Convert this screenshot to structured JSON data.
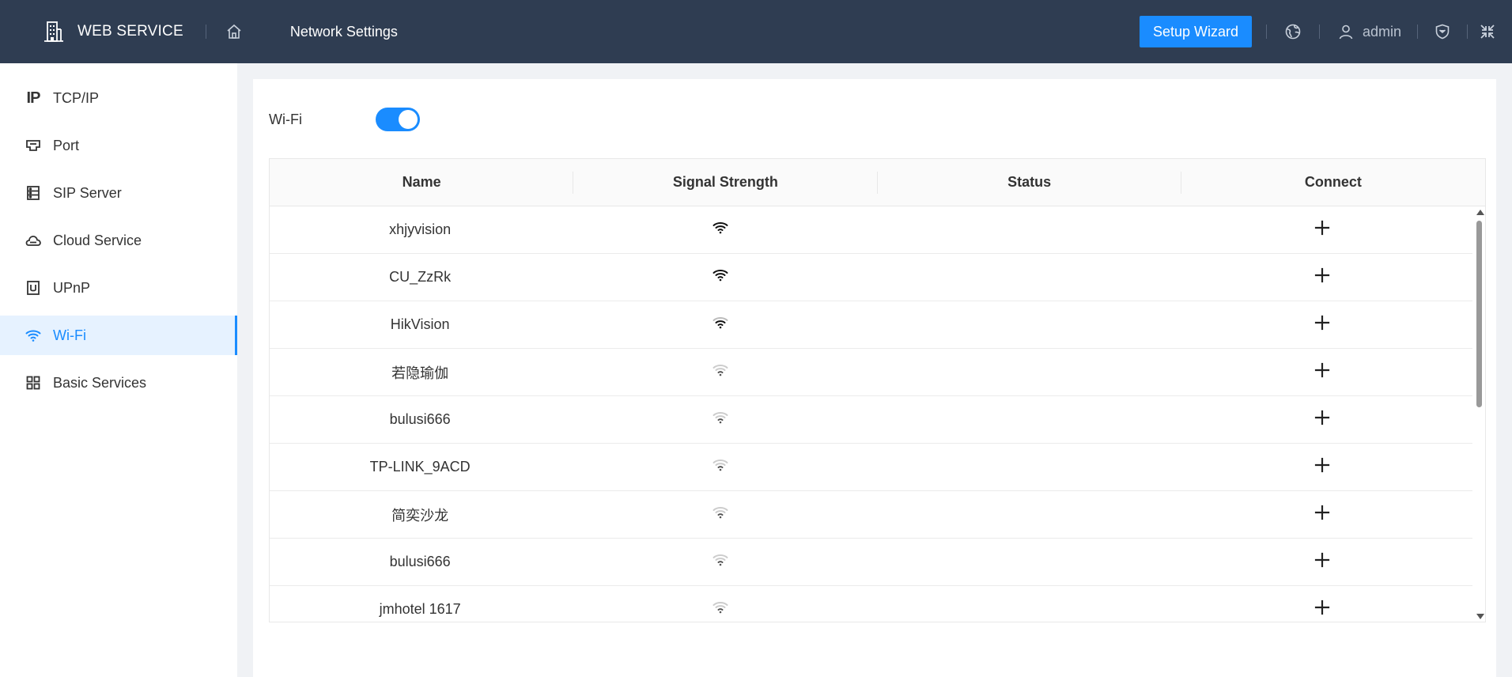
{
  "header": {
    "brand": "WEB SERVICE",
    "page_title": "Network Settings",
    "setup_wizard": "Setup Wizard",
    "user": "admin",
    "colors": {
      "bg": "#2f3d52",
      "accent": "#1a8cff"
    }
  },
  "sidebar": {
    "items": [
      {
        "label": "TCP/IP",
        "icon": "ip-icon"
      },
      {
        "label": "Port",
        "icon": "port-icon"
      },
      {
        "label": "SIP Server",
        "icon": "server-icon"
      },
      {
        "label": "Cloud Service",
        "icon": "cloud-icon"
      },
      {
        "label": "UPnP",
        "icon": "upnp-icon"
      },
      {
        "label": "Wi-Fi",
        "icon": "wifi-icon",
        "active": true
      },
      {
        "label": "Basic Services",
        "icon": "grid-icon"
      }
    ]
  },
  "main": {
    "wifi_label": "Wi-Fi",
    "wifi_enabled": true,
    "table": {
      "columns": [
        "Name",
        "Signal Strength",
        "Status",
        "Connect"
      ],
      "rows": [
        {
          "name": "xhjyvision",
          "signal": "strong",
          "status": ""
        },
        {
          "name": "CU_ZzRk",
          "signal": "strong",
          "status": ""
        },
        {
          "name": "HikVision",
          "signal": "medium",
          "status": ""
        },
        {
          "name": "若隐瑜伽",
          "signal": "weak",
          "status": ""
        },
        {
          "name": "bulusi666",
          "signal": "weak",
          "status": ""
        },
        {
          "name": "TP-LINK_9ACD",
          "signal": "weak",
          "status": ""
        },
        {
          "name": "简奕沙龙",
          "signal": "weak",
          "status": ""
        },
        {
          "name": "bulusi666",
          "signal": "weak",
          "status": ""
        },
        {
          "name": "jmhotel 1617",
          "signal": "weak",
          "status": ""
        }
      ]
    }
  }
}
